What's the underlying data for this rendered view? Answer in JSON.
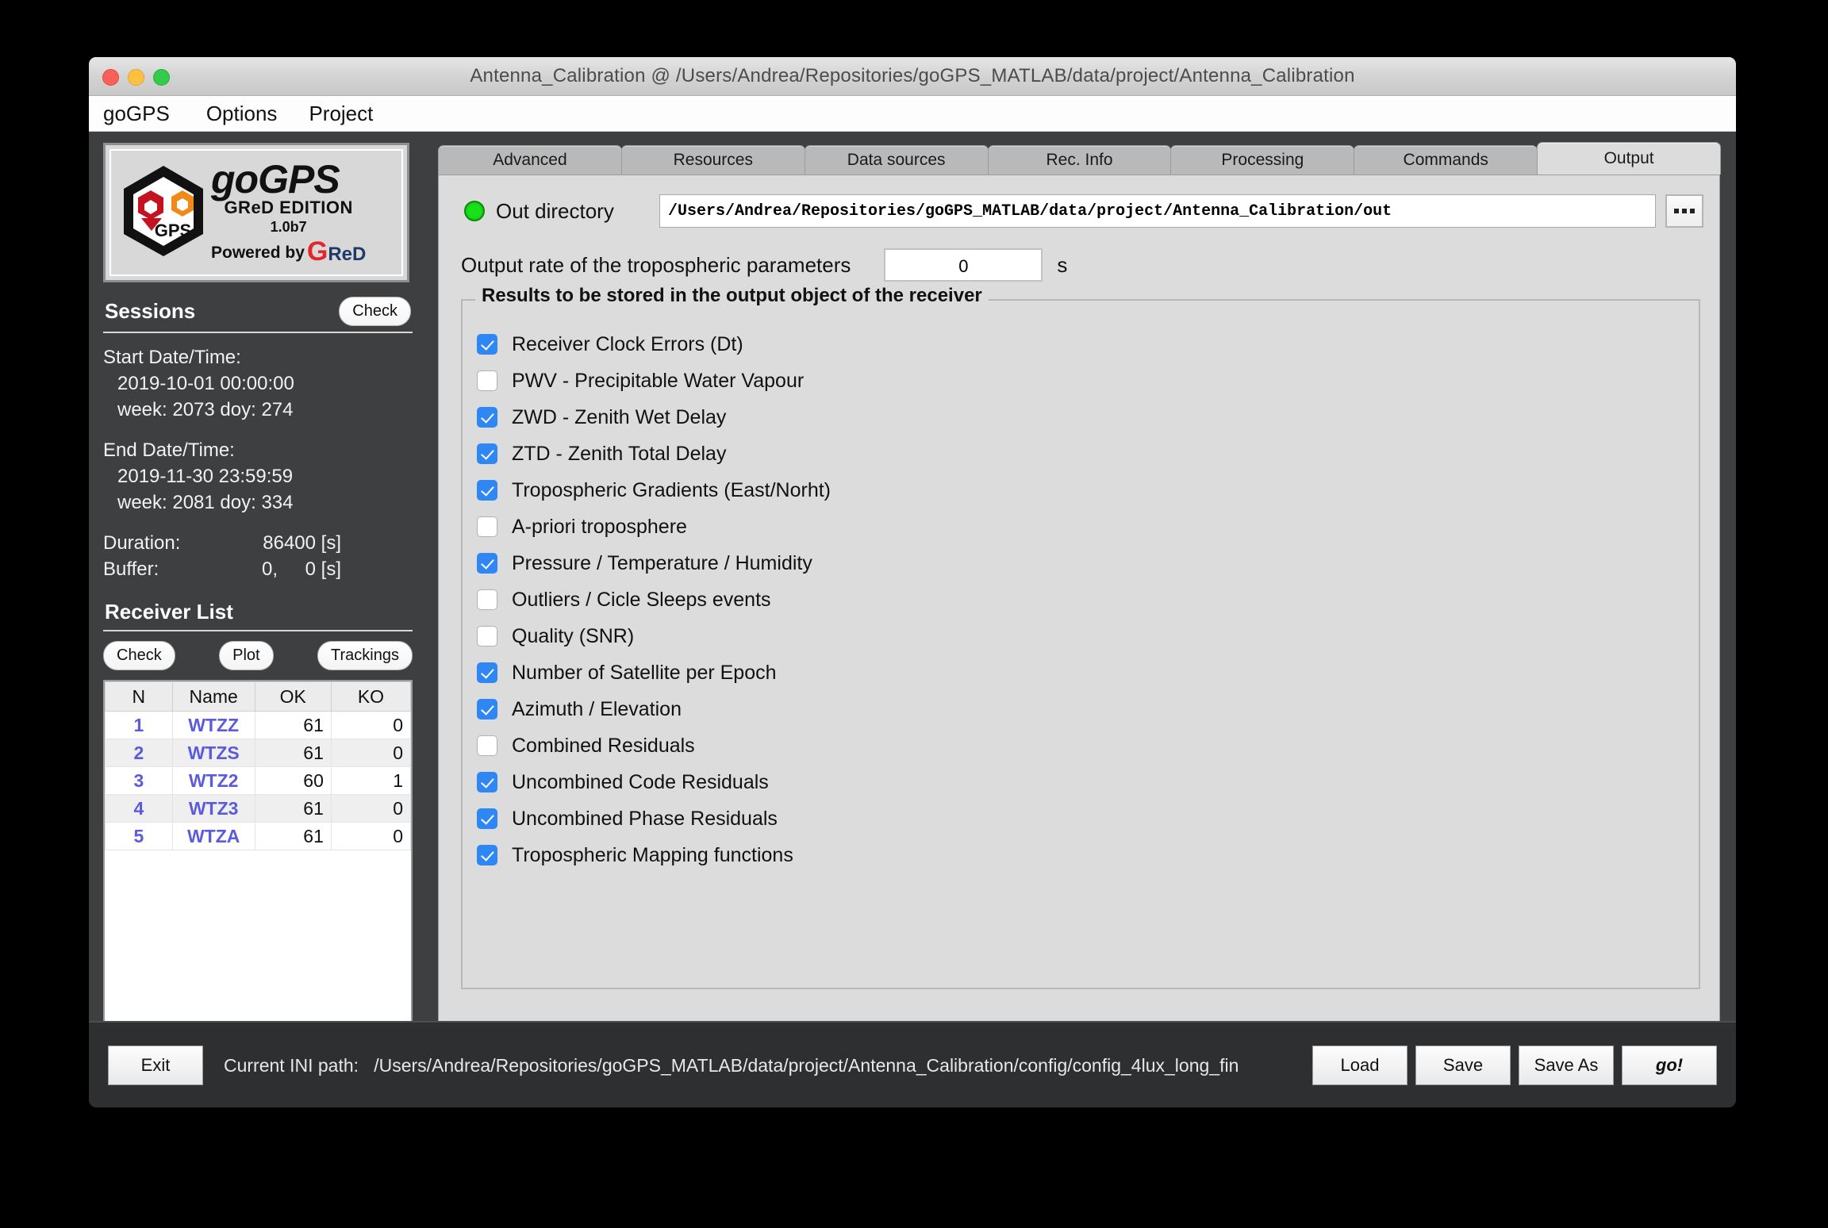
{
  "window": {
    "title": "Antenna_Calibration @ /Users/Andrea/Repositories/goGPS_MATLAB/data/project/Antenna_Calibration"
  },
  "menubar": {
    "items": [
      {
        "label": "goGPS"
      },
      {
        "label": "Options"
      },
      {
        "label": "Project"
      }
    ]
  },
  "logo": {
    "word": "goGPS",
    "edition": "GReD EDITION",
    "version": "1.0b7",
    "powered_by": "Powered by",
    "brand_g": "G",
    "brand_red": "ReD",
    "hex_label": "GPS"
  },
  "sessions": {
    "title": "Sessions",
    "check_label": "Check",
    "start_label": "Start Date/Time:",
    "start_datetime": "2019-10-01  00:00:00",
    "start_week_doy": "week: 2073 doy: 274",
    "end_label": "End Date/Time:",
    "end_datetime": "2019-11-30  23:59:59",
    "end_week_doy": "week: 2081 doy: 334",
    "duration_label": "Duration:",
    "duration_value": "86400 [s]",
    "buffer_label": "Buffer:",
    "buffer_value_1": "0,",
    "buffer_value_2": "0 [s]"
  },
  "receiver_list": {
    "title": "Receiver List",
    "buttons": [
      {
        "label": "Check"
      },
      {
        "label": "Plot"
      },
      {
        "label": "Trackings"
      }
    ],
    "columns": [
      "N",
      "Name",
      "OK",
      "KO"
    ],
    "rows": [
      {
        "n": "1",
        "name": "WTZZ",
        "ok": "61",
        "ko": "0"
      },
      {
        "n": "2",
        "name": "WTZS",
        "ok": "61",
        "ko": "0"
      },
      {
        "n": "3",
        "name": "WTZ2",
        "ok": "60",
        "ko": "1"
      },
      {
        "n": "4",
        "name": "WTZ3",
        "ok": "61",
        "ko": "0"
      },
      {
        "n": "5",
        "name": "WTZA",
        "ok": "61",
        "ko": "0"
      }
    ]
  },
  "tabs": [
    {
      "label": "Advanced",
      "active": false
    },
    {
      "label": "Resources",
      "active": false
    },
    {
      "label": "Data sources",
      "active": false
    },
    {
      "label": "Rec. Info",
      "active": false
    },
    {
      "label": "Processing",
      "active": false
    },
    {
      "label": "Commands",
      "active": false
    },
    {
      "label": "Output",
      "active": true
    }
  ],
  "output": {
    "out_dir_label": "Out directory",
    "out_dir_value": "/Users/Andrea/Repositories/goGPS_MATLAB/data/project/Antenna_Calibration/out",
    "browse_label": "...",
    "status_color": "#19e019",
    "rate_label": "Output rate of the tropospheric parameters",
    "rate_value": "0",
    "rate_unit": "s",
    "group_title": "Results to be stored in the output object of the receiver",
    "checkbox_accent": "#2f87f5",
    "checkboxes": [
      {
        "label": "Receiver Clock Errors (Dt)",
        "checked": true
      },
      {
        "label": "PWV - Precipitable Water Vapour",
        "checked": false
      },
      {
        "label": "ZWD - Zenith Wet Delay",
        "checked": true
      },
      {
        "label": "ZTD - Zenith Total Delay",
        "checked": true
      },
      {
        "label": "Tropospheric Gradients (East/Norht)",
        "checked": true
      },
      {
        "label": "A-priori troposphere",
        "checked": false
      },
      {
        "label": "Pressure / Temperature / Humidity",
        "checked": true
      },
      {
        "label": "Outliers / Cicle Sleeps events",
        "checked": false
      },
      {
        "label": "Quality (SNR)",
        "checked": false
      },
      {
        "label": "Number of Satellite per Epoch",
        "checked": true
      },
      {
        "label": "Azimuth / Elevation",
        "checked": true
      },
      {
        "label": "Combined Residuals",
        "checked": false
      },
      {
        "label": "Uncombined Code Residuals",
        "checked": true
      },
      {
        "label": "Uncombined Phase Residuals",
        "checked": true
      },
      {
        "label": "Tropospheric Mapping functions",
        "checked": true
      }
    ]
  },
  "footer": {
    "exit_label": "Exit",
    "ini_label": "Current INI path:",
    "ini_path": "/Users/Andrea/Repositories/goGPS_MATLAB/data/project/Antenna_Calibration/config/config_4lux_long_fin",
    "buttons": [
      {
        "label": "Load",
        "emphasis": false
      },
      {
        "label": "Save",
        "emphasis": false
      },
      {
        "label": "Save As",
        "emphasis": false
      },
      {
        "label": "go!",
        "emphasis": true
      }
    ]
  }
}
